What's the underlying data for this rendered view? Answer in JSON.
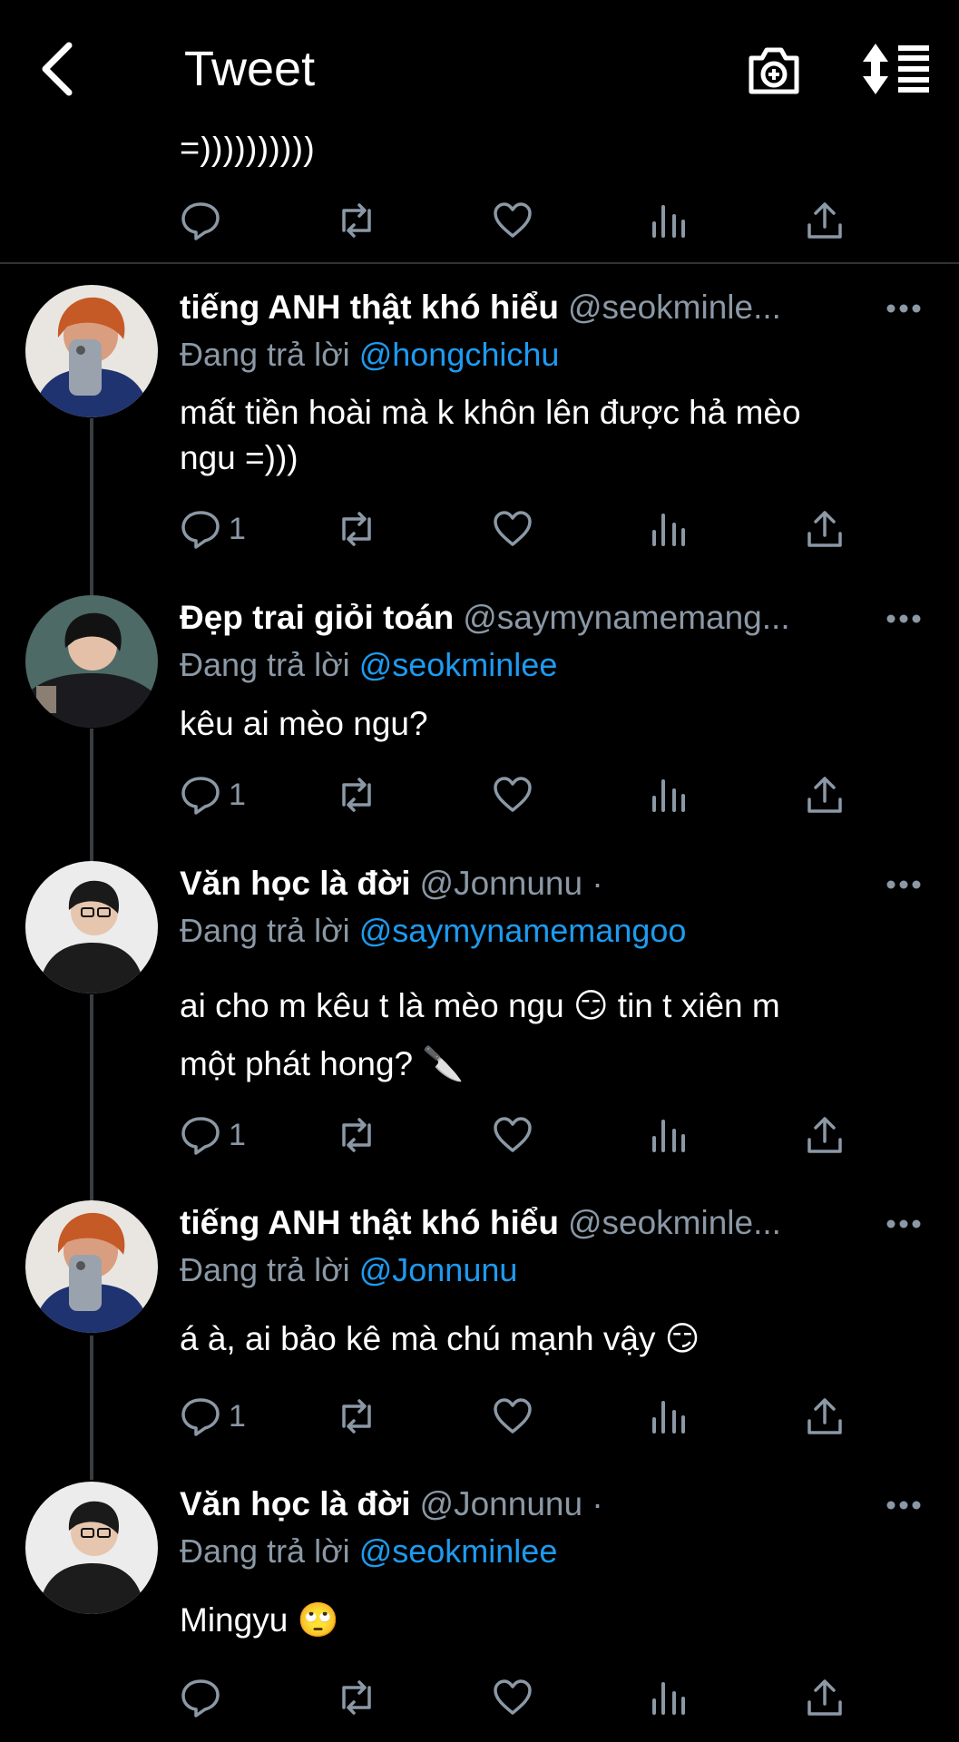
{
  "header": {
    "title": "Tweet",
    "back_icon": "chevron-left-icon",
    "camera_icon": "camera-plus-icon",
    "sort_icon": "sort-icon"
  },
  "previous_reply": {
    "text": "=))))))))))"
  },
  "colors": {
    "background": "#000000",
    "text": "#e7e9ea",
    "secondary": "#8b98a5",
    "mention": "#1d9bf0"
  },
  "tweets": [
    {
      "name": "tiếng ANH thật khó hiểu",
      "handle": "@seokminle...",
      "reply_prefix": "Đang trả lời",
      "reply_to": "@hongchichu",
      "text_lines": [
        "mất tiền hoài mà k khôn lên được hả mèo",
        "ngu =)))"
      ],
      "reply_count": "1"
    },
    {
      "name": "Đẹp trai giỏi toán",
      "handle": "@saymynamemang...",
      "reply_prefix": "Đang trả lời",
      "reply_to": "@seokminlee",
      "text_lines": [
        "kêu ai mèo ngu?"
      ],
      "reply_count": "1"
    },
    {
      "name": "Văn học là đời",
      "handle": "@Jonnunu ·",
      "reply_prefix": "Đang trả lời",
      "reply_to": "@saymynamemangoo",
      "text_lines": [
        "ai cho m kêu t là mèo ngu 😏  tin t xiên m",
        "một phát hong? 🔪"
      ],
      "reply_count": "1"
    },
    {
      "name": "tiếng ANH thật khó hiểu",
      "handle": "@seokminle...",
      "reply_prefix": "Đang trả lời",
      "reply_to": "@Jonnunu",
      "text_lines": [
        "á à, ai bảo kê mà chú mạnh vậy 😏"
      ],
      "reply_count": "1"
    },
    {
      "name": "Văn học là đời",
      "handle": "@Jonnunu ·",
      "reply_prefix": "Đang trả lời",
      "reply_to": "@seokminlee",
      "text_lines": [
        "Mingyu 🙄"
      ],
      "reply_count": ""
    }
  ]
}
